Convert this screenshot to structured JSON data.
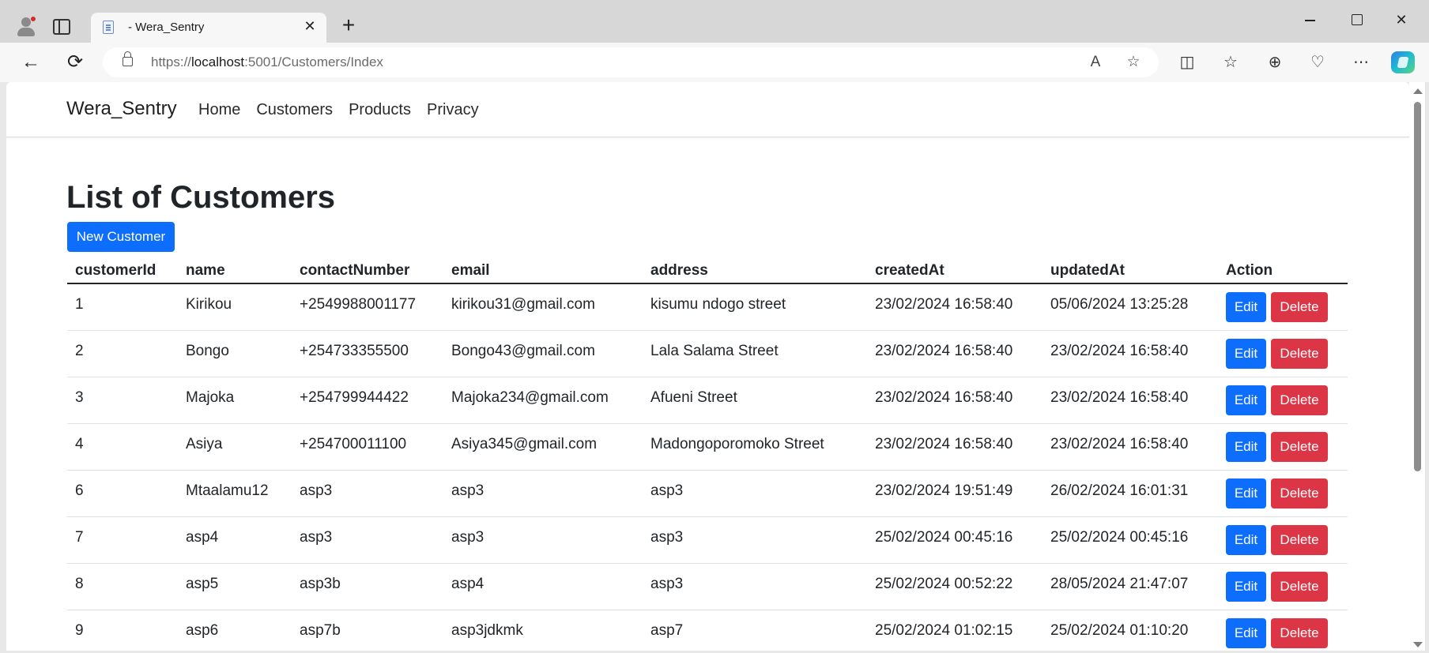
{
  "browser": {
    "tab_title": "- Wera_Sentry",
    "tab_close": "✕",
    "new_tab": "+",
    "url_scheme": "https://",
    "url_host": "localhost",
    "url_rest": ":5001/Customers/Index",
    "window_controls": {
      "close": "✕"
    },
    "icons": {
      "back": "←",
      "refresh": "⟳",
      "read_aloud": "A",
      "favorite": "☆",
      "split": "◫",
      "favorites": "☆",
      "collections": "⊕",
      "health": "♡",
      "more": "⋯"
    }
  },
  "navbar": {
    "brand": "Wera_Sentry",
    "links": [
      "Home",
      "Customers",
      "Products",
      "Privacy"
    ]
  },
  "page": {
    "title": "List of Customers",
    "new_button": "New Customer"
  },
  "table": {
    "headers": [
      "customerId",
      "name",
      "contactNumber",
      "email",
      "address",
      "createdAt",
      "updatedAt",
      "Action"
    ],
    "edit_label": "Edit",
    "delete_label": "Delete",
    "rows": [
      [
        "1",
        "Kirikou",
        "+2549988001177",
        "kirikou31@gmail.com",
        "kisumu ndogo street",
        "23/02/2024 16:58:40",
        "05/06/2024 13:25:28"
      ],
      [
        "2",
        "Bongo",
        "+254733355500",
        "Bongo43@gmail.com",
        "Lala Salama Street",
        "23/02/2024 16:58:40",
        "23/02/2024 16:58:40"
      ],
      [
        "3",
        "Majoka",
        "+254799944422",
        "Majoka234@gmail.com",
        "Afueni Street",
        "23/02/2024 16:58:40",
        "23/02/2024 16:58:40"
      ],
      [
        "4",
        "Asiya",
        "+254700011100",
        "Asiya345@gmail.com",
        "Madongoporomoko Street",
        "23/02/2024 16:58:40",
        "23/02/2024 16:58:40"
      ],
      [
        "6",
        "Mtaalamu12",
        "asp3",
        "asp3",
        "asp3",
        "23/02/2024 19:51:49",
        "26/02/2024 16:01:31"
      ],
      [
        "7",
        "asp4",
        "asp3",
        "asp3",
        "asp3",
        "25/02/2024 00:45:16",
        "25/02/2024 00:45:16"
      ],
      [
        "8",
        "asp5",
        "asp3b",
        "asp4",
        "asp3",
        "25/02/2024 00:52:22",
        "28/05/2024 21:47:07"
      ],
      [
        "9",
        "asp6",
        "asp7b",
        "asp3jdkmk",
        "asp7",
        "25/02/2024 01:02:15",
        "25/02/2024 01:10:20"
      ]
    ]
  },
  "colors": {
    "primary": "#0d6efd",
    "danger": "#dc3545",
    "text": "#212529"
  }
}
